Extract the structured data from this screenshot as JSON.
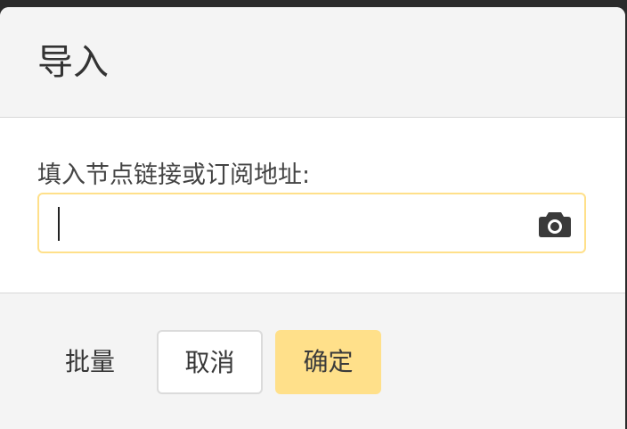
{
  "dialog": {
    "title": "导入",
    "field_label": "填入节点链接或订阅地址:",
    "input": {
      "value": "",
      "placeholder": ""
    },
    "camera_icon": "camera-icon",
    "buttons": {
      "batch": "批量",
      "cancel": "取消",
      "ok": "确定"
    }
  },
  "colors": {
    "accent": "#ffe08a",
    "backdrop": "#2b2b2b",
    "panel": "#f4f4f4",
    "body": "#ffffff"
  }
}
